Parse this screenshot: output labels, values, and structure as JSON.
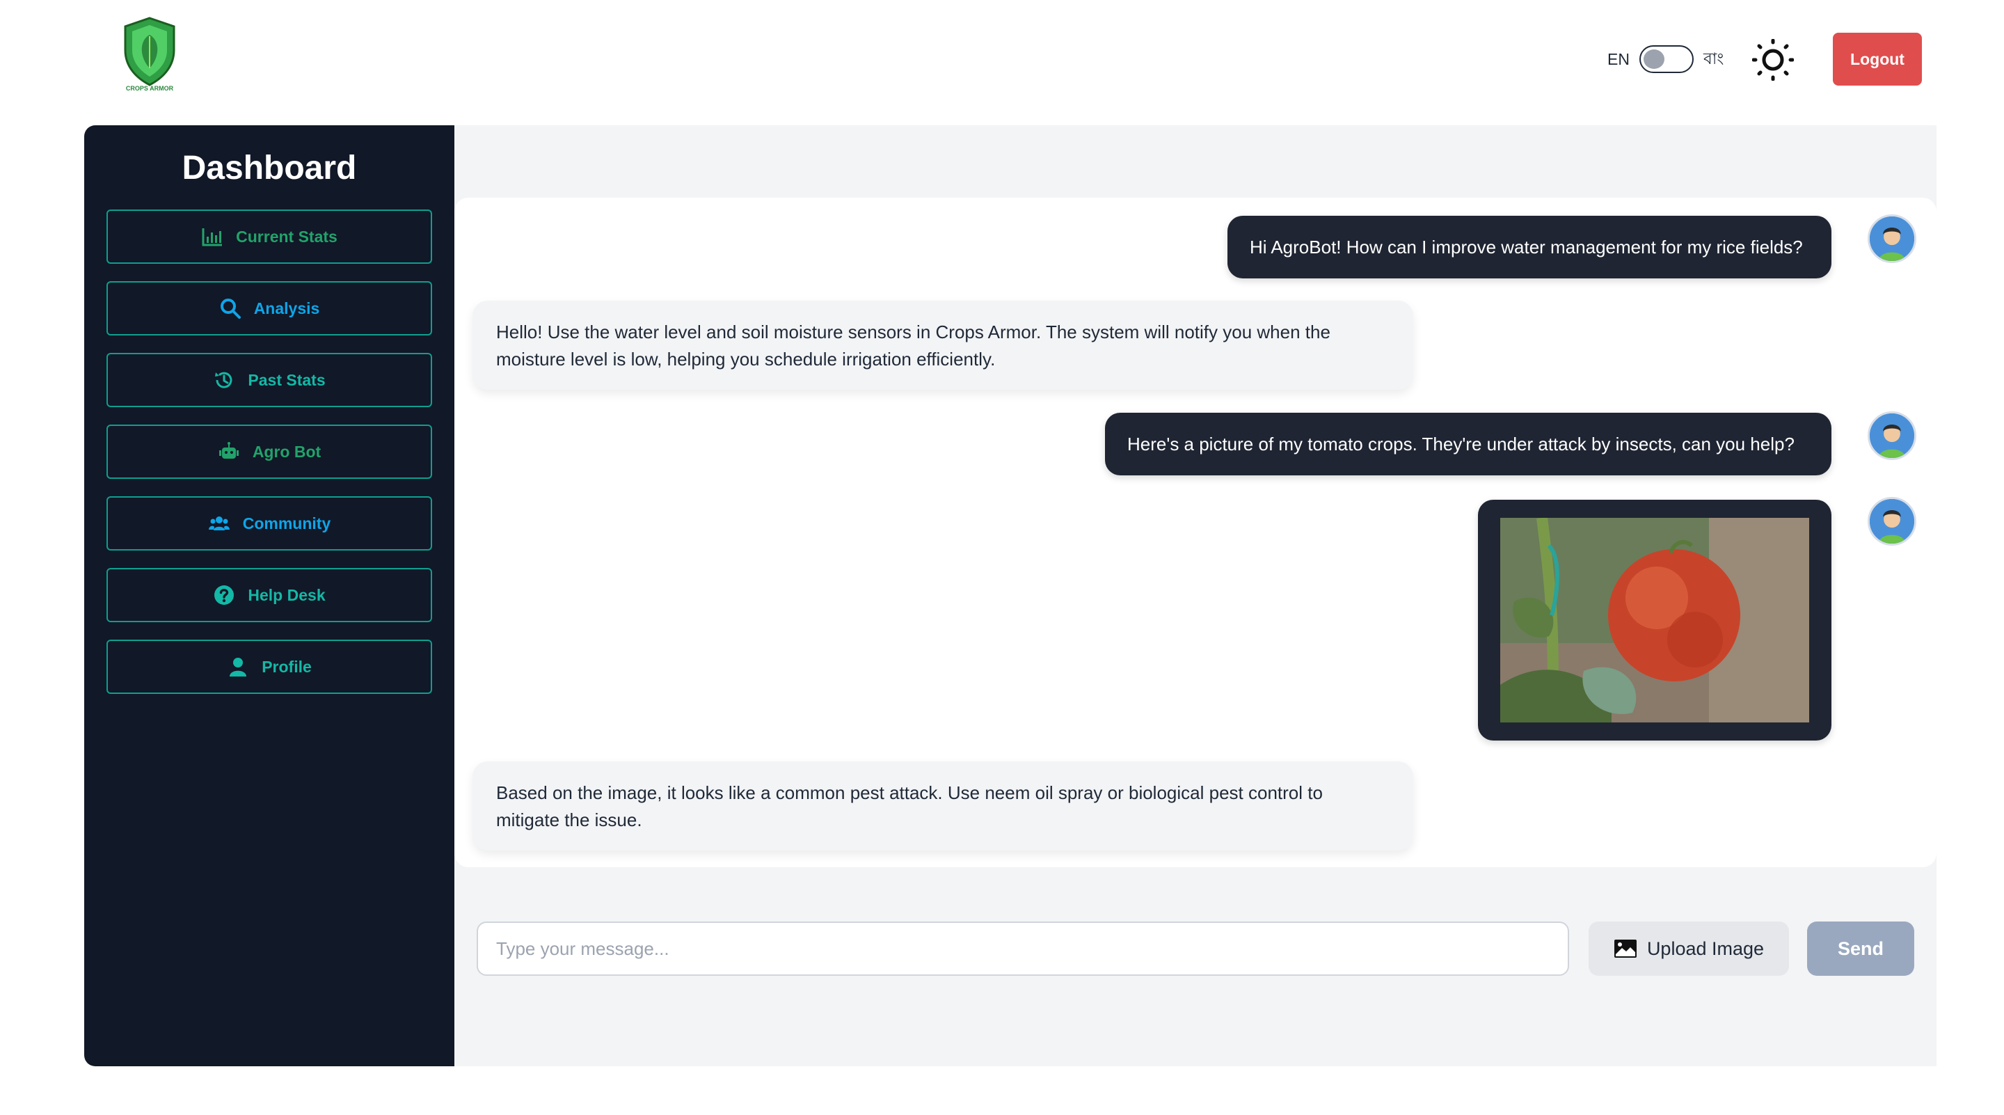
{
  "header": {
    "lang_left": "EN",
    "lang_right": "বাং",
    "logout_label": "Logout",
    "logo_text": "CROPS ARMOR"
  },
  "sidebar": {
    "title": "Dashboard",
    "items": [
      {
        "label": "Current Stats",
        "icon": "bar-chart-icon"
      },
      {
        "label": "Analysis",
        "icon": "search-icon"
      },
      {
        "label": "Past Stats",
        "icon": "history-icon"
      },
      {
        "label": "Agro Bot",
        "icon": "robot-icon"
      },
      {
        "label": "Community",
        "icon": "users-icon"
      },
      {
        "label": "Help Desk",
        "icon": "question-icon"
      },
      {
        "label": "Profile",
        "icon": "user-icon"
      }
    ]
  },
  "chat": {
    "messages": [
      {
        "role": "user",
        "text": "Hi AgroBot! How can I improve water management for my rice fields?"
      },
      {
        "role": "bot",
        "text": "Hello! Use the water level and soil moisture sensors in Crops Armor. The system will notify you when the moisture level is low, helping you schedule irrigation efficiently."
      },
      {
        "role": "user",
        "text": "Here's a picture of my tomato crops. They're under attack by insects, can you help?"
      },
      {
        "role": "user",
        "type": "image",
        "text": ""
      },
      {
        "role": "bot",
        "text": "Based on the image, it looks like a common pest attack. Use neem oil spray or biological pest control to mitigate the issue."
      }
    ]
  },
  "composer": {
    "placeholder": "Type your message...",
    "upload_label": "Upload Image",
    "send_label": "Send"
  },
  "colors": {
    "sidebar_bg": "#111827",
    "accent_teal": "#14b8a6",
    "logout_red": "#e04d4d",
    "send_disabled": "#9aa8bf"
  }
}
